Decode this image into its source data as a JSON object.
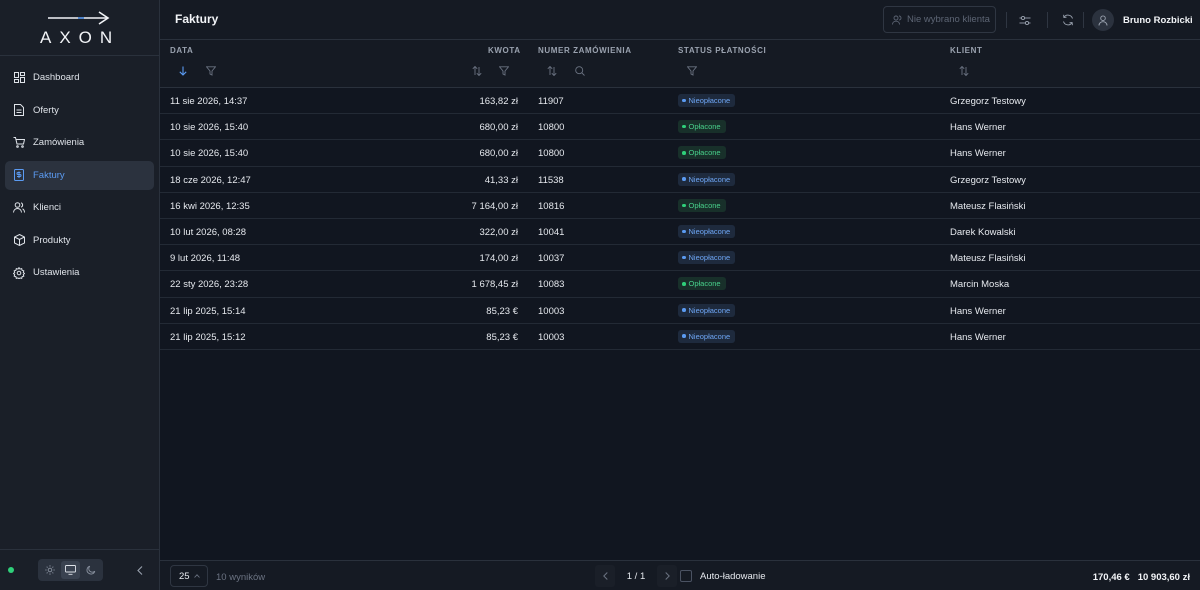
{
  "app": {
    "logo_text": "AXON"
  },
  "sidebar": {
    "items": [
      {
        "label": "Dashboard",
        "icon": "grid-icon"
      },
      {
        "label": "Oferty",
        "icon": "document-icon"
      },
      {
        "label": "Zamówienia",
        "icon": "cart-icon"
      },
      {
        "label": "Faktury",
        "icon": "invoice-icon",
        "active": true
      },
      {
        "label": "Klienci",
        "icon": "users-icon"
      },
      {
        "label": "Produkty",
        "icon": "box-icon"
      },
      {
        "label": "Ustawienia",
        "icon": "gear-icon"
      }
    ],
    "theme_modes": [
      "light",
      "system",
      "dark"
    ],
    "active_theme": "system"
  },
  "header": {
    "title": "Faktury",
    "client_placeholder": "Nie wybrano klienta",
    "user_name": "Bruno Rozbicki"
  },
  "table": {
    "columns": {
      "date": "DATA",
      "amount": "KWOTA",
      "order": "NUMER ZAMÓWIENIA",
      "status": "STATUS PŁATNOŚCI",
      "client": "KLIENT"
    },
    "rows": [
      {
        "date": "11 sie 2026, 14:37",
        "amount": "163,82 zł",
        "order": "11907",
        "status": "Nieopłacone",
        "paid": false,
        "client": "Grzegorz Testowy"
      },
      {
        "date": "10 sie 2026, 15:40",
        "amount": "680,00 zł",
        "order": "10800",
        "status": "Opłacone",
        "paid": true,
        "client": "Hans Werner"
      },
      {
        "date": "10 sie 2026, 15:40",
        "amount": "680,00 zł",
        "order": "10800",
        "status": "Opłacone",
        "paid": true,
        "client": "Hans Werner"
      },
      {
        "date": "18 cze 2026, 12:47",
        "amount": "41,33 zł",
        "order": "11538",
        "status": "Nieopłacone",
        "paid": false,
        "client": "Grzegorz Testowy"
      },
      {
        "date": "16 kwi 2026, 12:35",
        "amount": "7 164,00 zł",
        "order": "10816",
        "status": "Opłacone",
        "paid": true,
        "client": "Mateusz Flasiński"
      },
      {
        "date": "10 lut 2026, 08:28",
        "amount": "322,00 zł",
        "order": "10041",
        "status": "Nieopłacone",
        "paid": false,
        "client": "Darek Kowalski"
      },
      {
        "date": "9 lut 2026, 11:48",
        "amount": "174,00 zł",
        "order": "10037",
        "status": "Nieopłacone",
        "paid": false,
        "client": "Mateusz Flasiński"
      },
      {
        "date": "22 sty 2026, 23:28",
        "amount": "1 678,45 zł",
        "order": "10083",
        "status": "Opłacone",
        "paid": true,
        "client": "Marcin Moska"
      },
      {
        "date": "21 lip 2025, 15:14",
        "amount": "85,23 €",
        "order": "10003",
        "status": "Nieopłacone",
        "paid": false,
        "client": "Hans Werner"
      },
      {
        "date": "21 lip 2025, 15:12",
        "amount": "85,23 €",
        "order": "10003",
        "status": "Nieopłacone",
        "paid": false,
        "client": "Hans Werner"
      }
    ]
  },
  "footer": {
    "page_size": "25",
    "results": "10 wyników",
    "page_label": "1 / 1",
    "auto_load_label": "Auto-ładowanie",
    "auto_load_checked": false,
    "total_eur": "170,46 €",
    "total_pln": "10 903,60 zł"
  },
  "colors": {
    "accent": "#5b9bf2",
    "paid": "#2fd07a",
    "unpaid": "#5b9bf2",
    "background": "#111620",
    "sidebar": "#1a1f28"
  }
}
